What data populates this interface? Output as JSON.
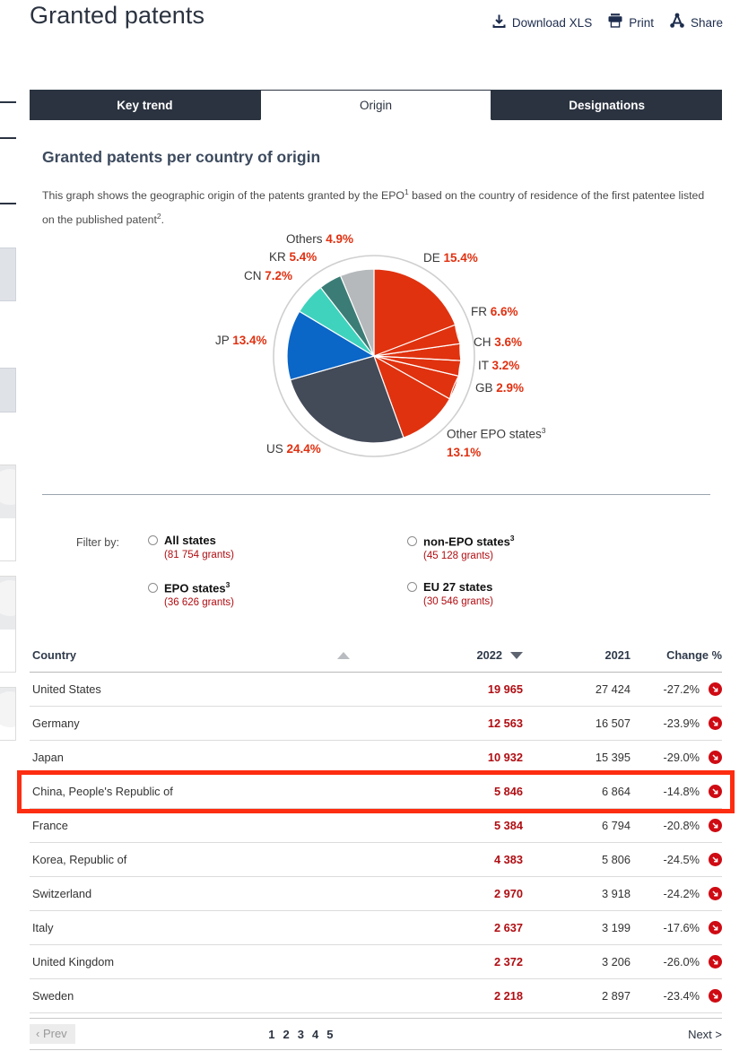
{
  "header": {
    "title": "Granted patents",
    "tools": [
      {
        "label": "Download XLS",
        "icon": "download-icon"
      },
      {
        "label": "Print",
        "icon": "print-icon"
      },
      {
        "label": "Share",
        "icon": "share-icon"
      }
    ]
  },
  "tabs": [
    {
      "label": "Key trend",
      "active": false
    },
    {
      "label": "Origin",
      "active": true
    },
    {
      "label": "Designations",
      "active": false
    }
  ],
  "section": {
    "title": "Granted patents per country of origin",
    "desc_1": "This graph shows the geographic origin of the patents granted by the EPO",
    "sup_1": "1",
    "desc_2": " based on the country of residence of the first patentee listed on the published patent",
    "sup_2": "2",
    "desc_3": "."
  },
  "chart_data": {
    "type": "pie",
    "title": "Granted patents per country of origin",
    "unit": "%",
    "legend_position": "around-slices",
    "categories": [
      "DE",
      "FR",
      "CH",
      "IT",
      "GB",
      "Other EPO states",
      "US",
      "JP",
      "CN",
      "KR",
      "Others"
    ],
    "values": [
      15.4,
      6.6,
      3.6,
      3.2,
      2.9,
      13.1,
      24.4,
      13.4,
      7.2,
      5.4,
      4.9
    ],
    "colors": [
      "#e0320f",
      "#e0320f",
      "#e0320f",
      "#e0320f",
      "#e0320f",
      "#e0320f",
      "#434a58",
      "#0a66c7",
      "#3fd3bd",
      "#3b7d76",
      "#b6b9bc"
    ],
    "labels": [
      {
        "key": "DE",
        "name": "DE",
        "value": "15.4%"
      },
      {
        "key": "FR",
        "name": "FR",
        "value": "6.6%"
      },
      {
        "key": "CH",
        "name": "CH",
        "value": "3.6%"
      },
      {
        "key": "IT",
        "name": "IT",
        "value": "3.2%"
      },
      {
        "key": "GB",
        "name": "GB",
        "value": "2.9%"
      },
      {
        "key": "OTHER_EPO",
        "name": "Other EPO states",
        "sup": "3",
        "value": "13.1%"
      },
      {
        "key": "US",
        "name": "US",
        "value": "24.4%"
      },
      {
        "key": "JP",
        "name": "JP",
        "value": "13.4%"
      },
      {
        "key": "CN",
        "name": "CN",
        "value": "7.2%"
      },
      {
        "key": "KR",
        "name": "KR",
        "value": "5.4%"
      },
      {
        "key": "OTHERS",
        "name": "Others",
        "value": "4.9%"
      }
    ]
  },
  "filters": {
    "label": "Filter by:",
    "options": [
      {
        "name": "All states",
        "sup": "",
        "grants": "(81 754 grants)",
        "selected": false
      },
      {
        "name": "non-EPO states",
        "sup": "3",
        "grants": "(45 128 grants)",
        "selected": false
      },
      {
        "name": "EPO states",
        "sup": "3",
        "grants": "(36 626 grants)",
        "selected": false
      },
      {
        "name": "EU 27 states",
        "sup": "",
        "grants": "(30 546 grants)",
        "selected": false
      }
    ]
  },
  "table": {
    "columns": {
      "country": "Country",
      "year_current": "2022",
      "year_prev": "2021",
      "change": "Change %"
    },
    "sort": {
      "country_dir": "asc",
      "current_dir": "desc"
    },
    "rows": [
      {
        "country": "United States",
        "y2022": "19 965",
        "y2021": "27 424",
        "change": "-27.2%",
        "trend": "down",
        "highlight": false
      },
      {
        "country": "Germany",
        "y2022": "12 563",
        "y2021": "16 507",
        "change": "-23.9%",
        "trend": "down",
        "highlight": false
      },
      {
        "country": "Japan",
        "y2022": "10 932",
        "y2021": "15 395",
        "change": "-29.0%",
        "trend": "down",
        "highlight": false
      },
      {
        "country": "China, People's Republic of",
        "y2022": "5 846",
        "y2021": "6 864",
        "change": "-14.8%",
        "trend": "down",
        "highlight": true
      },
      {
        "country": "France",
        "y2022": "5 384",
        "y2021": "6 794",
        "change": "-20.8%",
        "trend": "down",
        "highlight": false
      },
      {
        "country": "Korea, Republic of",
        "y2022": "4 383",
        "y2021": "5 806",
        "change": "-24.5%",
        "trend": "down",
        "highlight": false
      },
      {
        "country": "Switzerland",
        "y2022": "2 970",
        "y2021": "3 918",
        "change": "-24.2%",
        "trend": "down",
        "highlight": false
      },
      {
        "country": "Italy",
        "y2022": "2 637",
        "y2021": "3 199",
        "change": "-17.6%",
        "trend": "down",
        "highlight": false
      },
      {
        "country": "United Kingdom",
        "y2022": "2 372",
        "y2021": "3 206",
        "change": "-26.0%",
        "trend": "down",
        "highlight": false
      },
      {
        "country": "Sweden",
        "y2022": "2 218",
        "y2021": "2 897",
        "change": "-23.4%",
        "trend": "down",
        "highlight": false
      }
    ]
  },
  "pager": {
    "prev": "‹  Prev",
    "pages": [
      "1",
      "2",
      "3",
      "4",
      "5"
    ],
    "next": "Next >"
  },
  "colors": {
    "accent_red": "#b00d12",
    "pie_red": "#e0320f",
    "dark_navy": "#2b3340",
    "highlight": "#fd2d11"
  }
}
